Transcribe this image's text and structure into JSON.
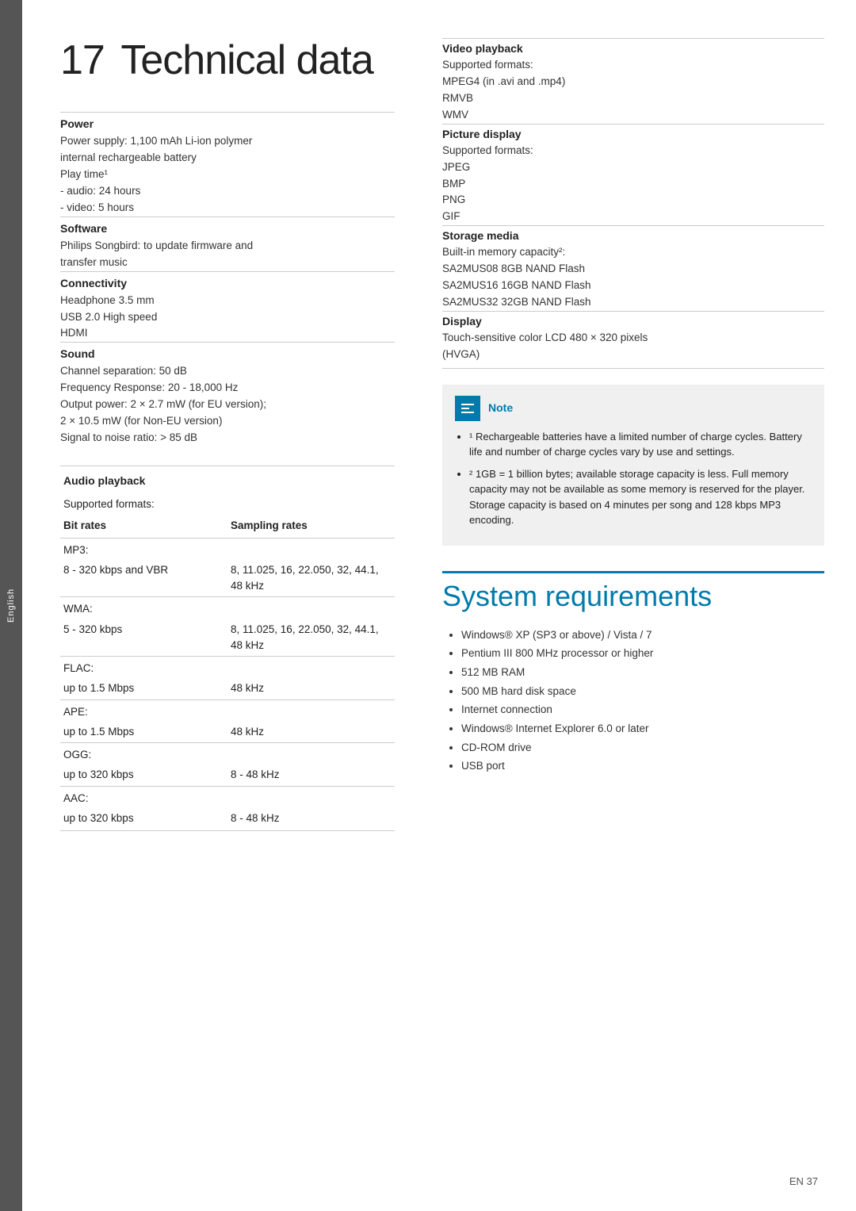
{
  "page": {
    "number": "EN 37",
    "side_tab": "English"
  },
  "title": {
    "number": "17",
    "text": "Technical data"
  },
  "left": {
    "sections": [
      {
        "id": "power",
        "title": "Power",
        "lines": [
          "Power supply: 1,100 mAh Li-ion polymer",
          "internal rechargeable battery",
          "Play time¹",
          "- audio: 24 hours",
          "- video: 5 hours"
        ]
      },
      {
        "id": "software",
        "title": "Software",
        "lines": [
          "Philips Songbird: to update firmware and",
          "transfer music"
        ]
      },
      {
        "id": "connectivity",
        "title": "Connectivity",
        "lines": [
          "Headphone 3.5 mm",
          "USB 2.0 High speed",
          "HDMI"
        ]
      },
      {
        "id": "sound",
        "title": "Sound",
        "lines": [
          "Channel separation: 50 dB",
          "Frequency Response: 20 - 18,000 Hz",
          "Output power: 2 × 2.7 mW (for EU version);",
          "2 × 10.5 mW (for Non-EU version)",
          "Signal to noise ratio: > 85 dB"
        ]
      }
    ],
    "audio_playback": {
      "title": "Audio playback",
      "supported_label": "Supported formats:",
      "col_headers": {
        "left": "Bit rates",
        "right": "Sampling rates"
      },
      "formats": [
        {
          "label": "MP3:",
          "bitrate": "8 - 320 kbps and VBR",
          "sampling": "8, 11.025, 16, 22.050, 32, 44.1, 48 kHz"
        },
        {
          "label": "WMA:",
          "bitrate": "5 - 320 kbps",
          "sampling": "8, 11.025, 16, 22.050, 32, 44.1, 48 kHz"
        },
        {
          "label": "FLAC:",
          "bitrate": "up to 1.5 Mbps",
          "sampling": "48 kHz"
        },
        {
          "label": "APE:",
          "bitrate": "up to 1.5 Mbps",
          "sampling": "48 kHz"
        },
        {
          "label": "OGG:",
          "bitrate": "up to 320 kbps",
          "sampling": "8 - 48 kHz"
        },
        {
          "label": "AAC:",
          "bitrate": "up to 320 kbps",
          "sampling": "8 - 48 kHz"
        }
      ]
    }
  },
  "right": {
    "sections": [
      {
        "id": "video-playback",
        "title": "Video playback",
        "lines": [
          "Supported formats:",
          "MPEG4 (in .avi and .mp4)",
          "RMVB",
          "WMV"
        ]
      },
      {
        "id": "picture-display",
        "title": "Picture display",
        "lines": [
          "Supported formats:",
          "JPEG",
          "BMP",
          "PNG",
          "GIF"
        ]
      },
      {
        "id": "storage-media",
        "title": "Storage media",
        "lines": [
          "Built-in memory capacity²:",
          "SA2MUS08 8GB NAND Flash",
          "SA2MUS16 16GB NAND Flash",
          "SA2MUS32 32GB NAND Flash"
        ]
      },
      {
        "id": "display",
        "title": "Display",
        "lines": [
          "Touch-sensitive color LCD 480 × 320 pixels",
          "(HVGA)"
        ]
      }
    ],
    "note": {
      "label": "Note",
      "items": [
        "¹ Rechargeable batteries have a limited number of charge cycles. Battery life and number of charge cycles vary by use and settings.",
        "² 1GB = 1 billion bytes; available storage capacity is less. Full memory capacity may not be available as some memory is reserved for the player. Storage capacity is based on 4 minutes per song and 128 kbps MP3 encoding."
      ]
    },
    "system_requirements": {
      "title": "System requirements",
      "items": [
        "Windows® XP (SP3 or above) / Vista / 7",
        "Pentium III 800 MHz processor or higher",
        "512 MB RAM",
        "500 MB hard disk space",
        "Internet connection",
        "Windows® Internet Explorer 6.0 or later",
        "CD-ROM drive",
        "USB port"
      ]
    }
  }
}
